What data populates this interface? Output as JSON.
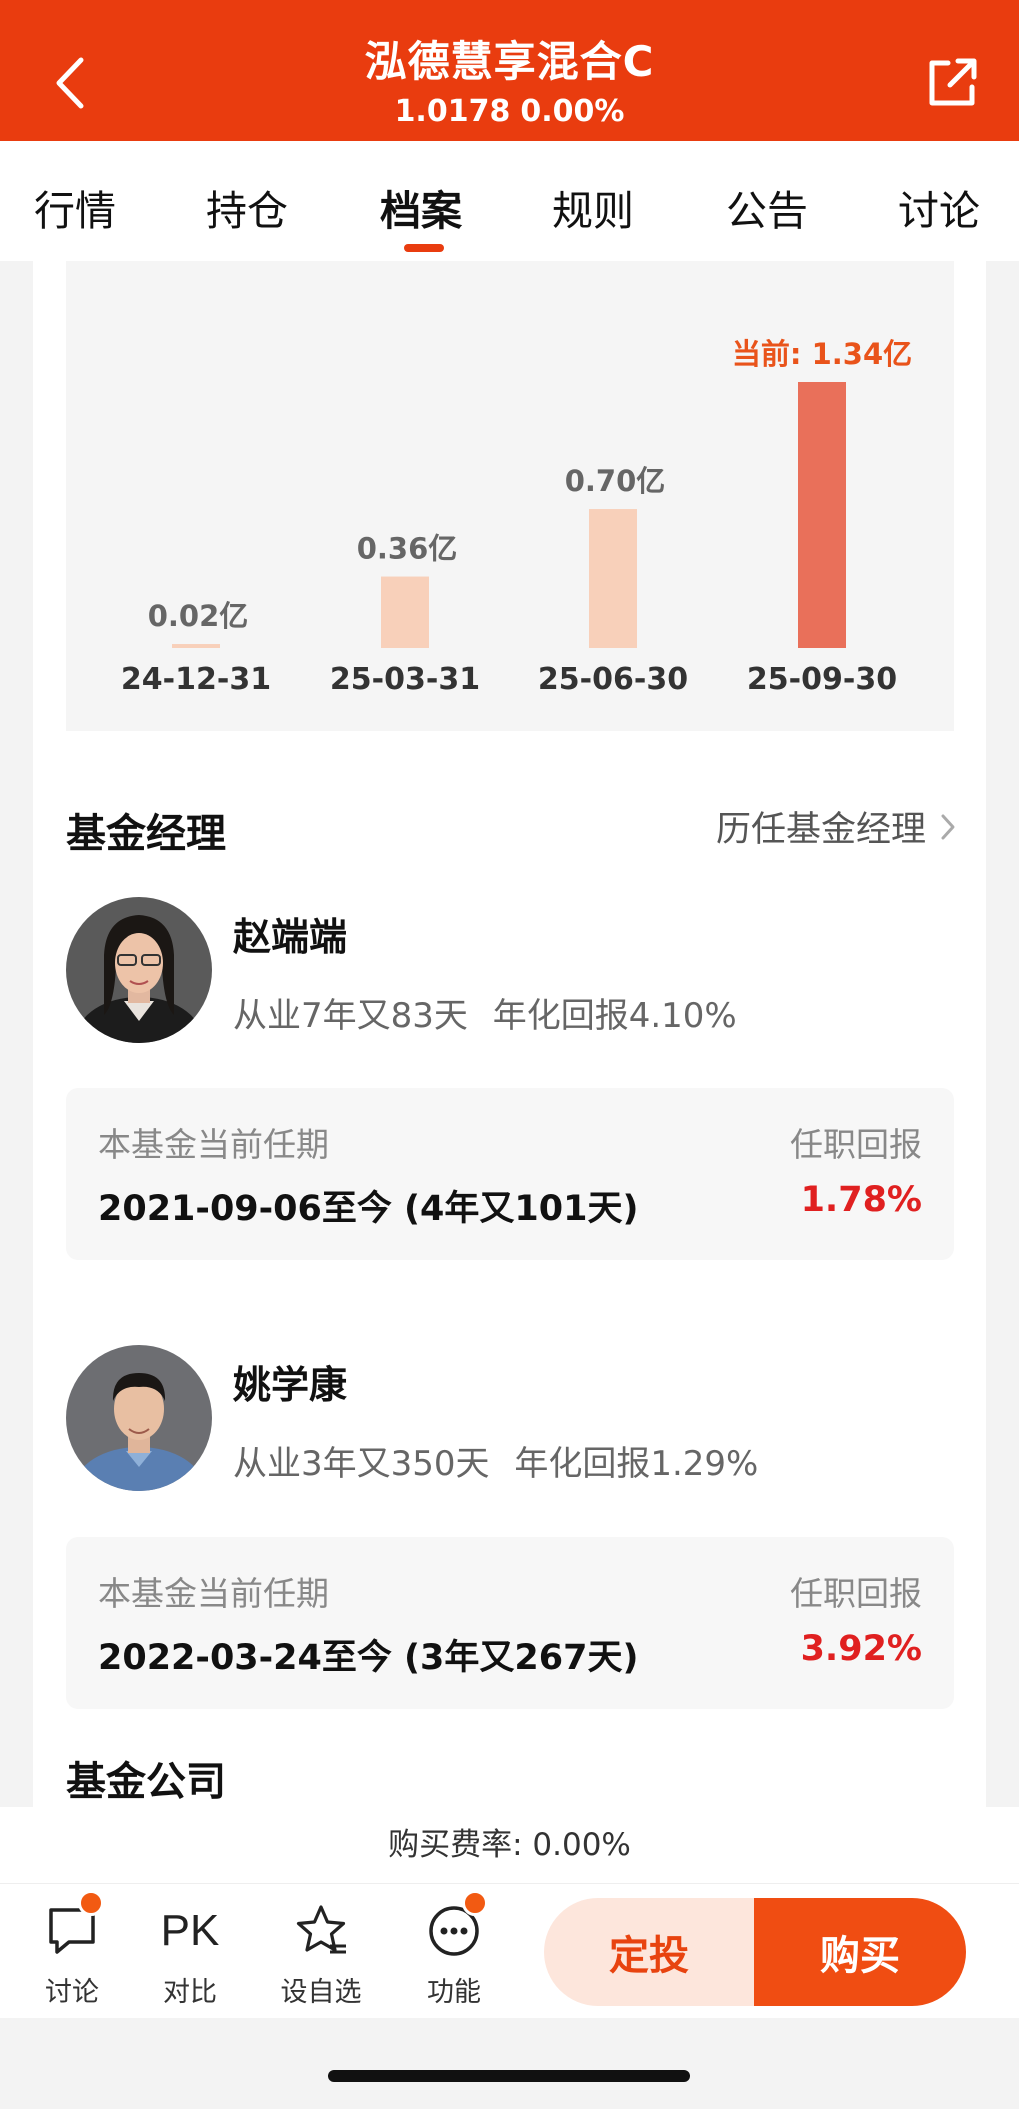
{
  "header": {
    "title": "泓德慧享混合C",
    "nav_value": "1.0178",
    "change": "0.00%",
    "back_icon": "chevron-left-icon",
    "share_icon": "share-icon",
    "color": "#e93c0f"
  },
  "tabs": [
    "行情",
    "持仓",
    "档案",
    "规则",
    "公告",
    "讨论"
  ],
  "active_tab": "档案",
  "chart_data": {
    "type": "bar",
    "categories": [
      "24-12-31",
      "25-03-31",
      "25-06-30",
      "25-09-30"
    ],
    "values": [
      0.02,
      0.36,
      0.7,
      1.34
    ],
    "value_labels": [
      "0.02亿",
      "0.36亿",
      "0.70亿",
      "当前: 1.34亿"
    ],
    "unit": "亿",
    "colors": {
      "bar": "#f8d0ba",
      "current_bar": "#e9705a",
      "current_label": "#e9531a"
    }
  },
  "managers_section": {
    "title": "基金经理",
    "history_link": "历任基金经理",
    "managers": [
      {
        "name": "赵端端",
        "experience": "从业7年又83天",
        "annual_return": "年化回报4.10%",
        "tenure_label": "本基金当前任期",
        "tenure_range": "2021-09-06至今 (4年又101天)",
        "return_label": "任职回报",
        "return_value": "1.78%"
      },
      {
        "name": "姚学康",
        "experience": "从业3年又350天",
        "annual_return": "年化回报1.29%",
        "tenure_label": "本基金当前任期",
        "tenure_range": "2022-03-24至今 (3年又267天)",
        "return_label": "任职回报",
        "return_value": "3.92%"
      }
    ]
  },
  "company_section": {
    "title": "基金公司"
  },
  "fee": "购买费率: 0.00%",
  "bottom_bar": {
    "items": [
      {
        "label": "讨论",
        "icon": "chat-bubble-icon"
      },
      {
        "label": "对比",
        "icon": "pk-icon",
        "icon_text": "PK"
      },
      {
        "label": "设自选",
        "icon": "star-icon"
      },
      {
        "label": "功能",
        "icon": "more-icon"
      }
    ],
    "plan_button": "定投",
    "buy_button": "购买"
  }
}
